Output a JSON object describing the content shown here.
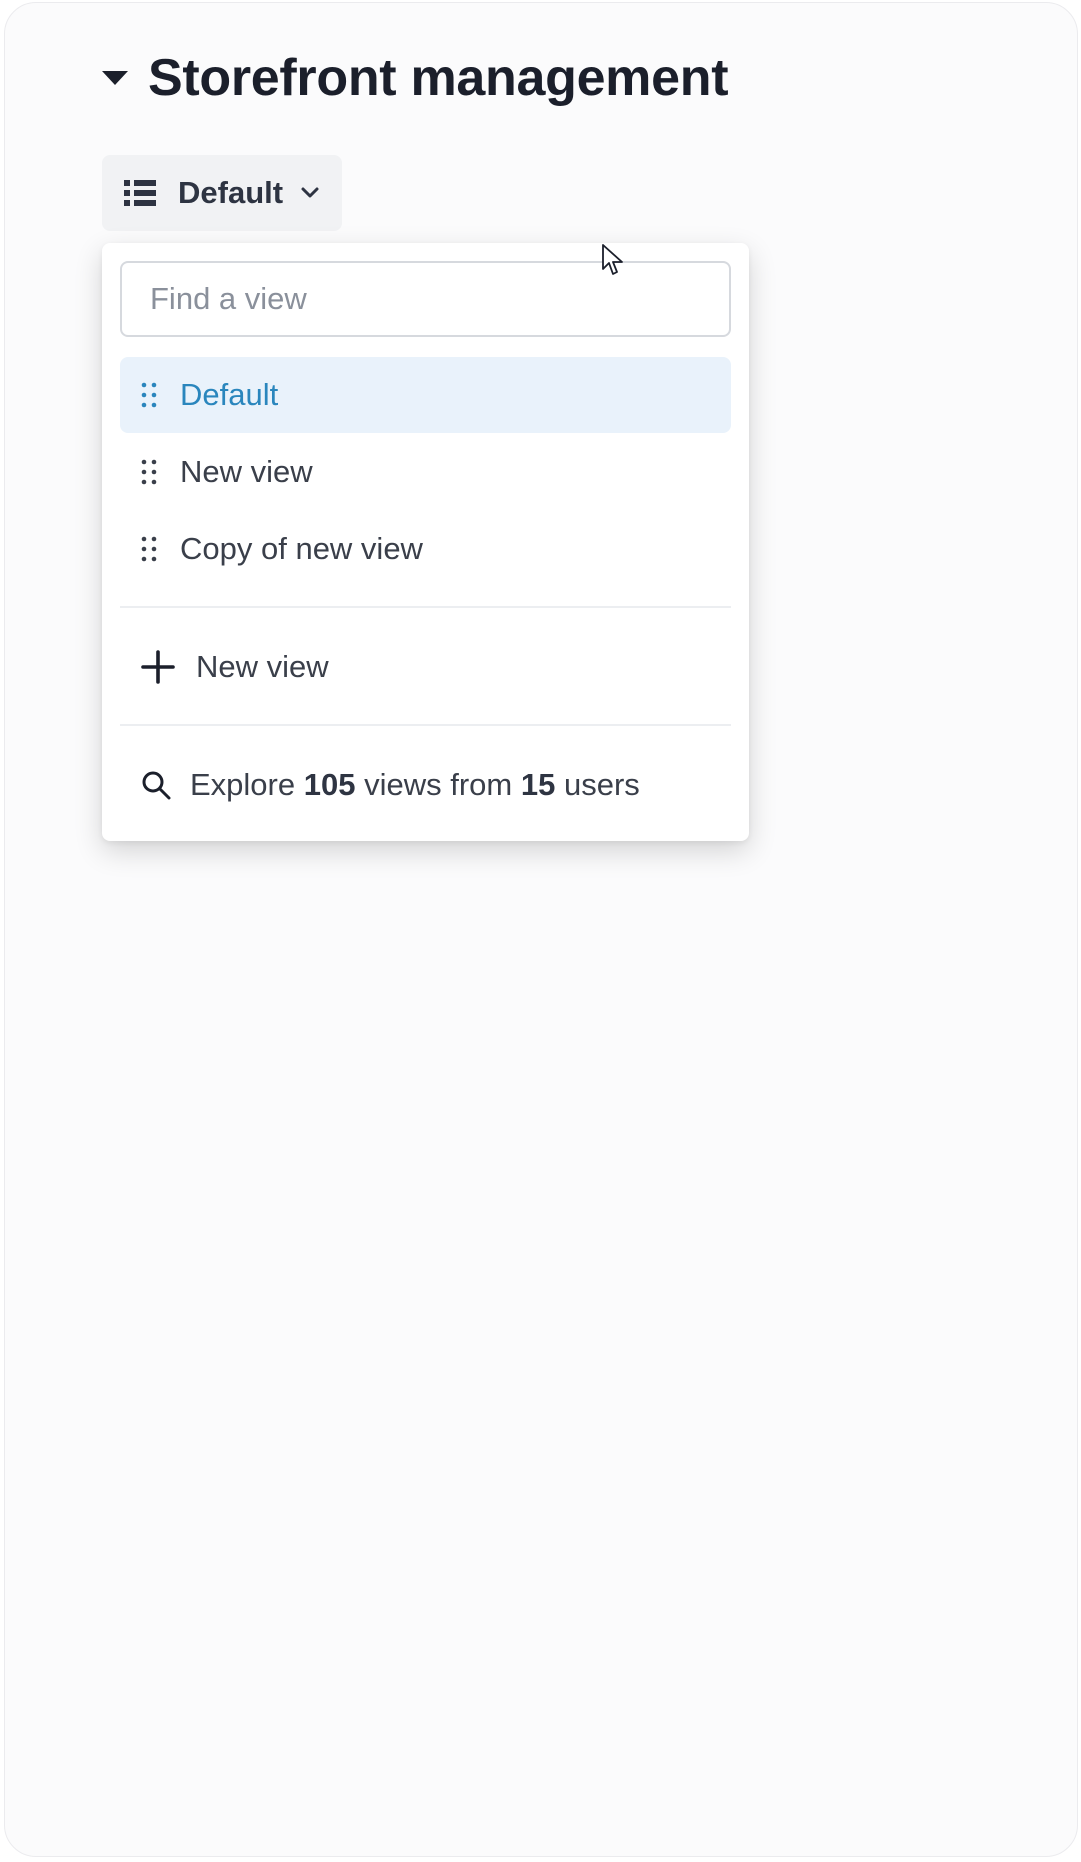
{
  "header": {
    "title": "Storefront management"
  },
  "view_selector": {
    "label": "Default",
    "icon": "list-icon",
    "chevron": "chevron-down-icon"
  },
  "dropdown": {
    "search_placeholder": "Find a view",
    "views": [
      {
        "label": "Default",
        "selected": true
      },
      {
        "label": "New view",
        "selected": false
      },
      {
        "label": "Copy of new view",
        "selected": false
      }
    ],
    "new_view_label": "New view",
    "explore": {
      "prefix": "Explore",
      "views_count": "105",
      "middle": "views from",
      "users_count": "15",
      "suffix": "users"
    }
  },
  "colors": {
    "accent": "#2a86bd",
    "selected_bg": "#e9f2fb",
    "text": "#3a3f4a",
    "title": "#1b1f2b"
  }
}
